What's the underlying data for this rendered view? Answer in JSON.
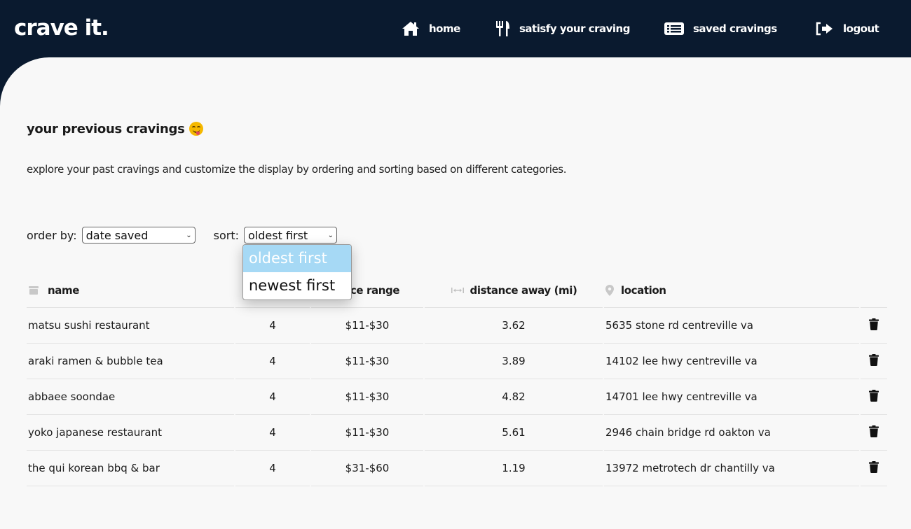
{
  "nav": {
    "brand": "crave it.",
    "items": [
      {
        "label": "home",
        "icon": "home-icon"
      },
      {
        "label": "satisfy your craving",
        "icon": "utensils-icon"
      },
      {
        "label": "saved cravings",
        "icon": "list-icon"
      },
      {
        "label": "logout",
        "icon": "logout-icon"
      }
    ]
  },
  "page": {
    "title": "your previous cravings",
    "title_emoji": "face-savoring-food-emoji",
    "subtitle": "explore your past cravings and customize the display by ordering and sorting based on different categories."
  },
  "controls": {
    "order_label": "order by:",
    "order_value": "date saved",
    "sort_label": "sort:",
    "sort_value": "oldest first",
    "sort_options": [
      "oldest first",
      "newest first"
    ],
    "sort_highlighted": "oldest first"
  },
  "table": {
    "headers": {
      "name": "name",
      "price": "price range",
      "distance": "distance away (mi)",
      "location": "location"
    },
    "rows": [
      {
        "name": "matsu sushi restaurant",
        "rating": "4",
        "price": "$11-$30",
        "distance": "3.62",
        "location": "5635 stone rd centreville va"
      },
      {
        "name": "araki ramen & bubble tea",
        "rating": "4",
        "price": "$11-$30",
        "distance": "3.89",
        "location": "14102 lee hwy centreville va"
      },
      {
        "name": "abbaee soondae",
        "rating": "4",
        "price": "$11-$30",
        "distance": "4.82",
        "location": "14701 lee hwy centreville va"
      },
      {
        "name": "yoko japanese restaurant",
        "rating": "4",
        "price": "$11-$30",
        "distance": "5.61",
        "location": "2946 chain bridge rd oakton va"
      },
      {
        "name": "the qui korean bbq & bar",
        "rating": "4",
        "price": "$31-$60",
        "distance": "1.19",
        "location": "13972 metrotech dr chantilly va"
      }
    ]
  },
  "colors": {
    "navbar": "#0a1a2f",
    "content_bg": "#f8f8f8",
    "dropdown_highlight": "#a6d9f5"
  }
}
